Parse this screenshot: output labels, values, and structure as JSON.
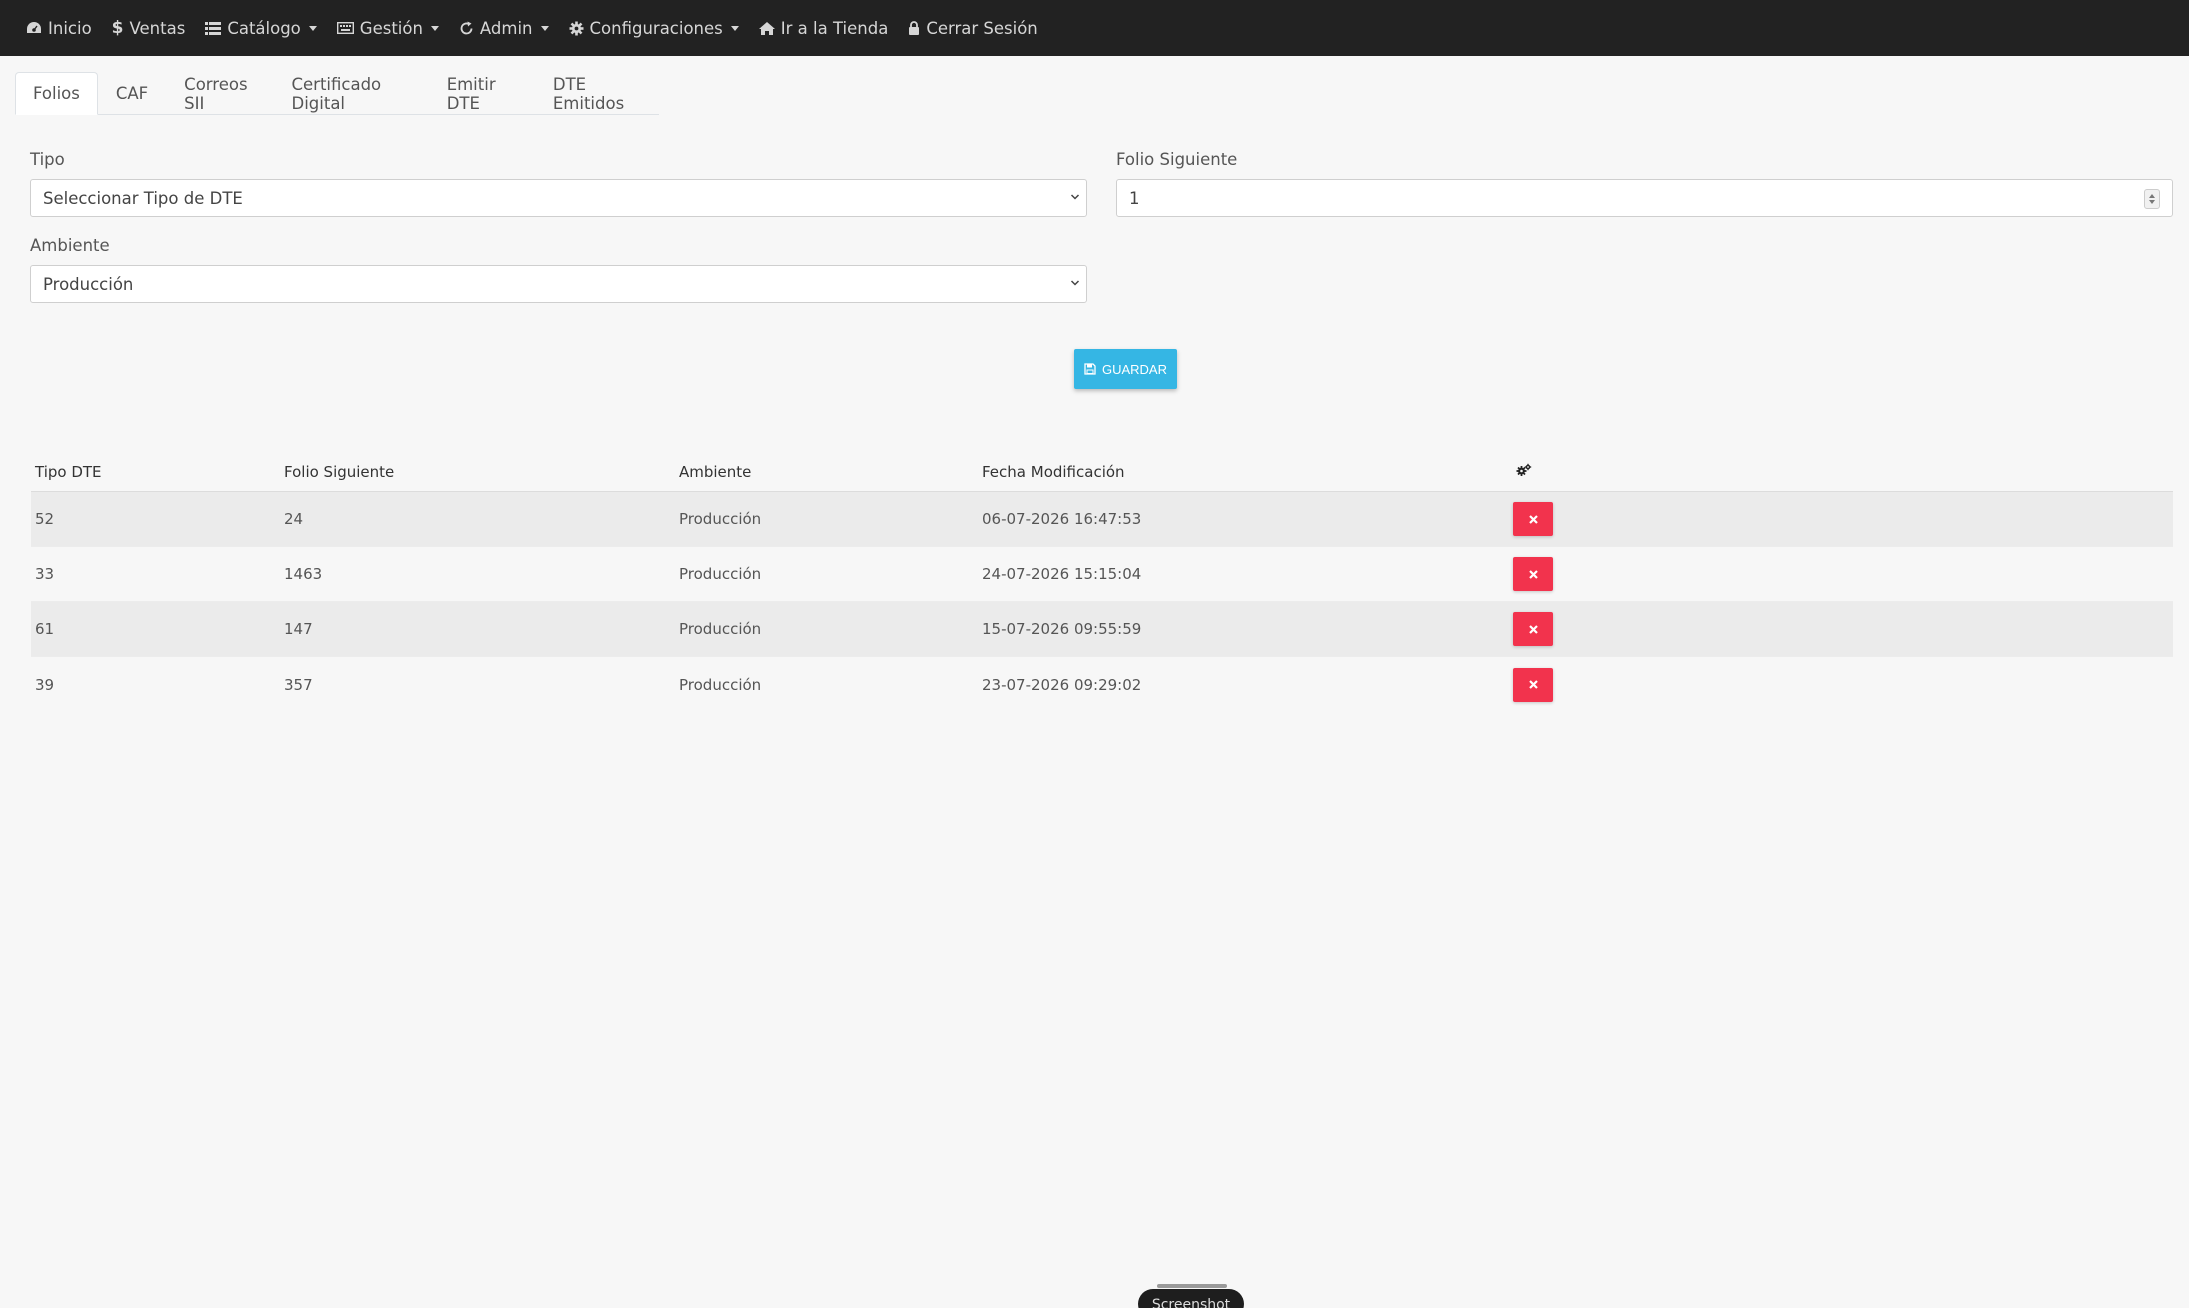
{
  "nav": {
    "items": [
      {
        "label": "Inicio",
        "icon": "dashboard-icon",
        "caret": false
      },
      {
        "label": "Ventas",
        "icon": "dollar-icon",
        "caret": false
      },
      {
        "label": "Catálogo",
        "icon": "list-icon",
        "caret": true
      },
      {
        "label": "Gestión",
        "icon": "keyboard-icon",
        "caret": true
      },
      {
        "label": "Admin",
        "icon": "refresh-icon",
        "caret": true
      },
      {
        "label": "Configuraciones",
        "icon": "gear-icon",
        "caret": true
      },
      {
        "label": "Ir a la Tienda",
        "icon": "home-icon",
        "caret": false
      },
      {
        "label": "Cerrar Sesión",
        "icon": "lock-icon",
        "caret": false
      }
    ]
  },
  "tabs": [
    {
      "label": "Folios",
      "active": true
    },
    {
      "label": "CAF",
      "active": false
    },
    {
      "label": "Correos SII",
      "active": false
    },
    {
      "label": "Certificado Digital",
      "active": false
    },
    {
      "label": "Emitir DTE",
      "active": false
    },
    {
      "label": "DTE Emitidos",
      "active": false
    }
  ],
  "form": {
    "tipo_label": "Tipo",
    "tipo_value": "Seleccionar Tipo de DTE",
    "folio_label": "Folio Siguiente",
    "folio_value": "1",
    "ambiente_label": "Ambiente",
    "ambiente_value": "Producción",
    "save_label": "GUARDAR"
  },
  "table": {
    "headers": [
      "Tipo DTE",
      "Folio Siguiente",
      "Ambiente",
      "Fecha Modificación"
    ],
    "actions_icon": "cogs-icon",
    "rows": [
      {
        "tipo": "52",
        "folio": "24",
        "ambiente": "Producción",
        "fecha": "06-07-2026 16:47:53"
      },
      {
        "tipo": "33",
        "folio": "1463",
        "ambiente": "Producción",
        "fecha": "24-07-2026 15:15:04"
      },
      {
        "tipo": "61",
        "folio": "147",
        "ambiente": "Producción",
        "fecha": "15-07-2026 09:55:59"
      },
      {
        "tipo": "39",
        "folio": "357",
        "ambiente": "Producción",
        "fecha": "23-07-2026 09:29:02"
      }
    ]
  },
  "overlay": {
    "screenshot_label": "Screenshot"
  },
  "colors": {
    "navbar": "#222222",
    "save": "#35b6e4",
    "delete": "#f2334d"
  }
}
